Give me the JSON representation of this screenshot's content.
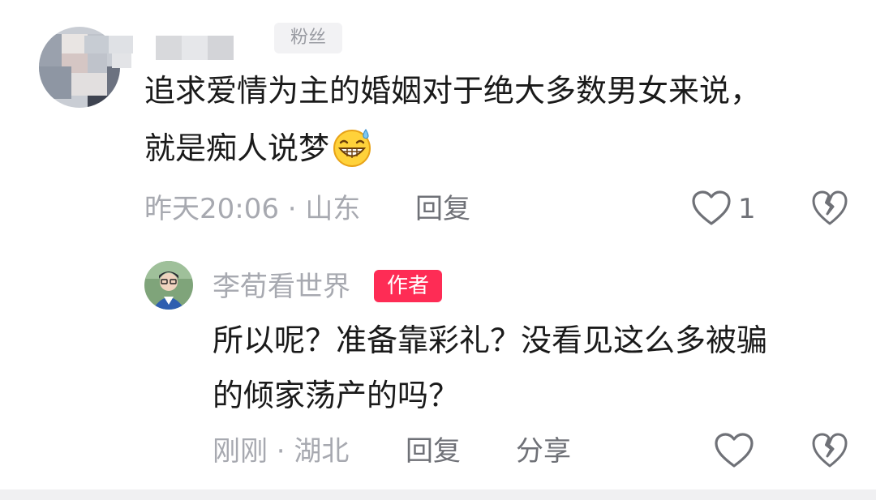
{
  "comment": {
    "avatar_icon": "pixelated-avatar",
    "username_icon": "pixelated-username",
    "badge": "粉丝",
    "text_line1": "追求爱情为主的婚姻对于绝大多数男女来说，",
    "text_line2": "就是痴人说梦",
    "emoji_icon": "grinning-sweat-emoji",
    "time_location": "昨天20:06 · 山东",
    "reply_label": "回复",
    "like_icon": "heart-outline-icon",
    "like_count": "1",
    "dislike_icon": "broken-heart-icon"
  },
  "reply": {
    "avatar_icon": "user-avatar",
    "username": "李荀看世界",
    "badge": "作者",
    "text_line1": "所以呢？准备靠彩礼？没看见这么多被骗",
    "text_line2": "的倾家荡产的吗？",
    "time_location": "刚刚 · 湖北",
    "reply_label": "回复",
    "share_label": "分享",
    "like_icon": "heart-outline-icon",
    "dislike_icon": "broken-heart-icon"
  },
  "colors": {
    "author_badge": "#fe2c55",
    "meta_text": "#a7a9b0",
    "body_text": "#1a1a1a"
  }
}
